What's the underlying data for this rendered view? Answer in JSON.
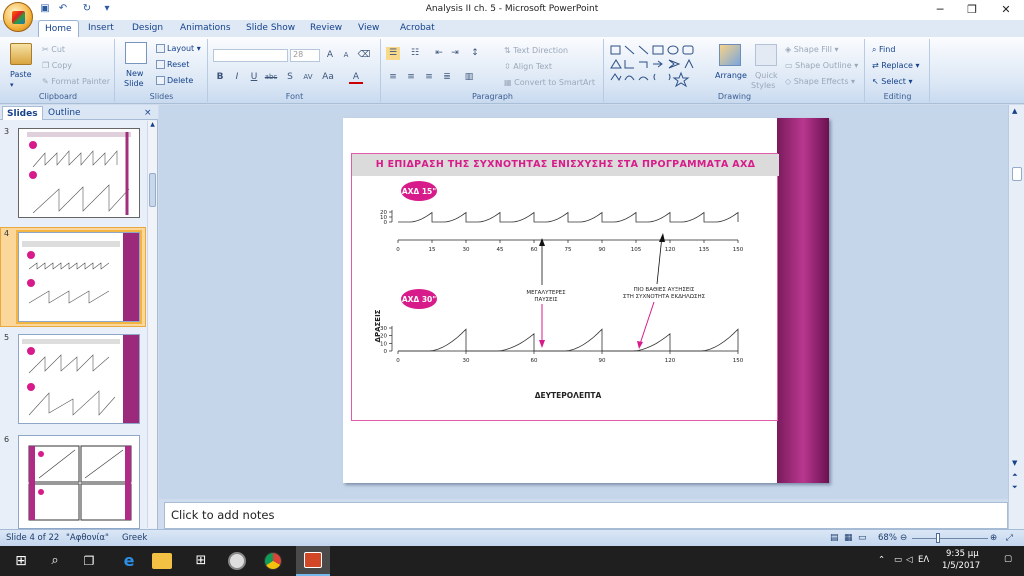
{
  "window": {
    "title": "Analysis II ch. 5 - Microsoft PowerPoint"
  },
  "quick_access": [
    "save-icon",
    "undo-icon",
    "redo-icon",
    "customize-icon"
  ],
  "tabs": [
    "Home",
    "Insert",
    "Design",
    "Animations",
    "Slide Show",
    "Review",
    "View",
    "Acrobat"
  ],
  "ribbon": {
    "clipboard": {
      "label": "Clipboard",
      "paste": "Paste",
      "cut": "Cut",
      "copy": "Copy",
      "format_painter": "Format Painter"
    },
    "slides": {
      "label": "Slides",
      "new_slide": "New",
      "new_slide2": "Slide",
      "layout": "Layout",
      "reset": "Reset",
      "delete": "Delete"
    },
    "font": {
      "label": "Font",
      "size": "28"
    },
    "paragraph": {
      "label": "Paragraph",
      "text_direction": "Text Direction",
      "align_text": "Align Text",
      "convert_smartart": "Convert to SmartArt"
    },
    "drawing": {
      "label": "Drawing",
      "arrange": "Arrange",
      "quick_styles": "Quick",
      "quick_styles2": "Styles",
      "shape_fill": "Shape Fill",
      "shape_outline": "Shape Outline",
      "shape_effects": "Shape Effects"
    },
    "editing": {
      "label": "Editing",
      "find": "Find",
      "replace": "Replace",
      "select": "Select"
    }
  },
  "left_panel": {
    "tab_slides": "Slides",
    "tab_outline": "Outline",
    "close": "×",
    "thumbs": [
      "3",
      "4",
      "5",
      "6"
    ]
  },
  "slide": {
    "title": "Η ΕΠΙΔΡΑΣΗ ΤΗΣ ΣΥΧΝΟΤΗΤΑΣ ΕΝΙΣΧΥΣΗΣ ΣΤΑ ΠΡΟΓΡΑΜΜΑΤΑ ΑΧΔ",
    "badge_top": "ΑΧΔ 15\"",
    "badge_bottom": "ΑΧΔ 30\"",
    "ylabel": "ΔΡΑΣΕΙΣ",
    "xlabel": "ΔΕΥΤΕΡΟΛΕΠΤΑ",
    "annot1_line1": "ΜΕΓΑΛΥΤΕΡΕΣ",
    "annot1_line2": "ΠΑΥΣΕΙΣ",
    "annot2_line1": "ΠΙΟ ΒΑΘΙΕΣ ΑΥΞΗΣΕΙΣ",
    "annot2_line2": "ΣΤΗ ΣΥΧΝΟΤΗΤΑ ΕΚΔΗΛΩΣΗΣ"
  },
  "chart_data": [
    {
      "type": "line",
      "name": "ΑΧΔ 15\"",
      "x_ticks": [
        "0",
        "15",
        "30",
        "45",
        "60",
        "75",
        "90",
        "105",
        "120",
        "135",
        "150"
      ],
      "y_ticks": [
        "0",
        "10",
        "20"
      ],
      "xlim": [
        0,
        150
      ],
      "ylim": [
        0,
        20
      ],
      "reinforcement_interval": 15
    },
    {
      "type": "line",
      "name": "ΑΧΔ 30\"",
      "x_ticks": [
        "0",
        "30",
        "60",
        "90",
        "120",
        "150"
      ],
      "y_ticks": [
        "0",
        "10",
        "20",
        "30"
      ],
      "xlim": [
        0,
        150
      ],
      "ylim": [
        0,
        30
      ],
      "xlabel": "ΔΕΥΤΕΡΟΛΕΠΤΑ",
      "ylabel": "ΔΡΑΣΕΙΣ",
      "reinforcement_interval": 30
    }
  ],
  "notes": {
    "placeholder": "Click to add notes"
  },
  "status": {
    "slide": "Slide 4 of 22",
    "theme": "\"Αφθονία\"",
    "language": "Greek",
    "zoom": "68%"
  },
  "taskbar": {
    "lang": "ΕΛ",
    "time": "9:35 μμ",
    "date": "1/5/2017"
  },
  "colors": {
    "accent": "#d81b8a",
    "ribbon": "#dbe7f5"
  }
}
